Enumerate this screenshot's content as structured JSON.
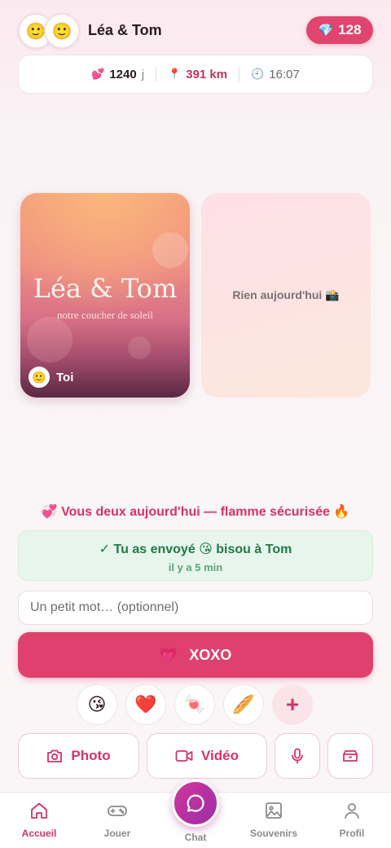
{
  "header": {
    "avatar_left": "🙂",
    "avatar_right": "🙂",
    "couple_name": "Léa & Tom",
    "gems_icon": "💎",
    "gems_count": "128"
  },
  "stats": {
    "days_icon": "💕",
    "days_value": "1240",
    "days_unit": "j",
    "distance_icon": "📍",
    "distance_value": "391 km",
    "time_icon": "🕘",
    "time_value": "16:07"
  },
  "photos": {
    "left_card": {
      "title": "Léa & Tom",
      "subtitle": "notre coucher de soleil",
      "owner_avatar": "🙂",
      "owner_label": "Toi"
    },
    "right_card": {
      "empty_label": "Rien aujourd'hui 📸"
    }
  },
  "streak": {
    "text": "💞 Vous deux aujourd'hui — flamme sécurisée 🔥"
  },
  "sent": {
    "message": "✓ Tu as envoyé 😘 bisou à Tom",
    "time_ago": "il y a 5 min"
  },
  "note": {
    "placeholder": "Un petit mot… (optionnel)",
    "value": ""
  },
  "xoxo": {
    "icon": "💗",
    "label": "XOXO"
  },
  "quick_emojis": [
    "😘",
    "❤️",
    "🍬",
    "🥖"
  ],
  "quick_add": "+",
  "media": {
    "photo_label": "Photo",
    "video_label": "Vidéo"
  },
  "nav": {
    "home": "Accueil",
    "play": "Jouer",
    "chat": "Chat",
    "memories": "Souvenirs",
    "profile": "Profil"
  },
  "colors": {
    "accent": "#e0406d",
    "accent_text": "#d4336a",
    "success_bg": "#e8f5ec",
    "success_text": "#1f7a45"
  }
}
